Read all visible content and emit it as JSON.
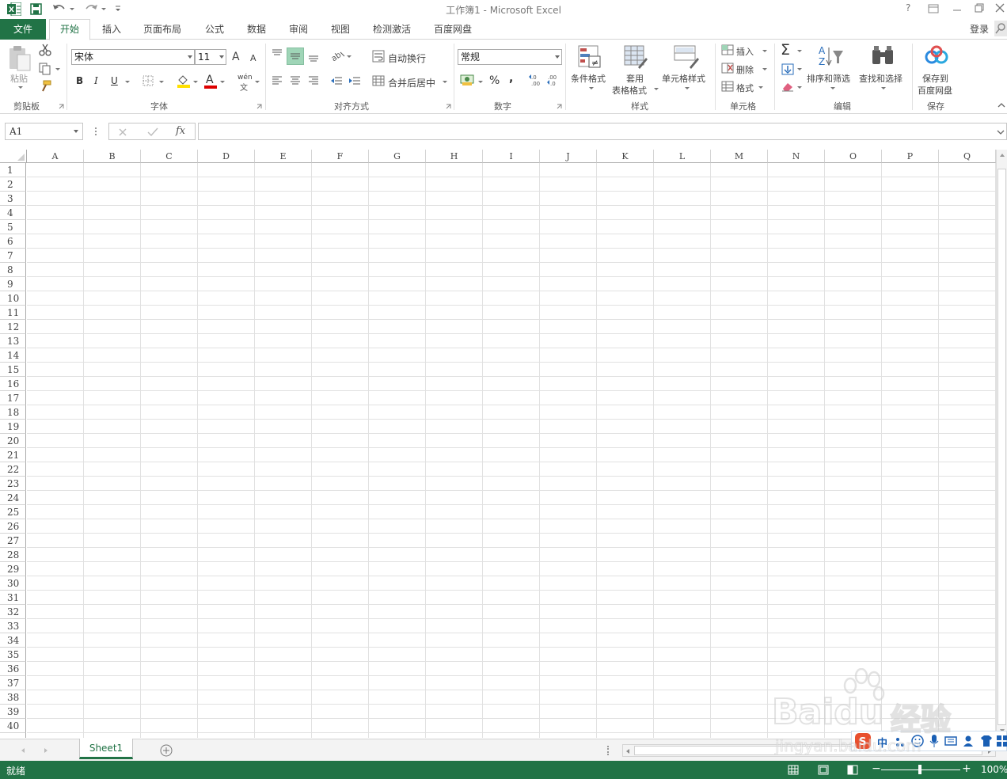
{
  "app": {
    "window_title": "工作簿1 - Microsoft Excel",
    "login": "登录",
    "help": "?"
  },
  "tabs": [
    {
      "label": "文件"
    },
    {
      "label": "开始"
    },
    {
      "label": "插入"
    },
    {
      "label": "页面布局"
    },
    {
      "label": "公式"
    },
    {
      "label": "数据"
    },
    {
      "label": "审阅"
    },
    {
      "label": "视图"
    },
    {
      "label": "检测激活"
    },
    {
      "label": "百度网盘"
    }
  ],
  "ribbon": {
    "clipboard": {
      "label": "剪贴板",
      "paste": "粘贴"
    },
    "font": {
      "label": "字体",
      "family": "宋体",
      "size": "11",
      "bold": "B",
      "italic": "I",
      "underline": "U",
      "grow": "A",
      "shrink": "A",
      "font_color": "A",
      "phonetic": "wén"
    },
    "alignment": {
      "label": "对齐方式",
      "wrap": "自动换行",
      "merge": "合并后居中"
    },
    "number": {
      "label": "数字",
      "format": "常规",
      "percent": "%",
      "comma": ","
    },
    "styles": {
      "label": "样式",
      "conditional": "条件格式",
      "table_format_1": "套用",
      "table_format_2": "表格格式",
      "cell_styles": "单元格样式"
    },
    "cells": {
      "label": "单元格",
      "insert": "插入",
      "delete": "删除",
      "format": "格式"
    },
    "editing": {
      "label": "编辑",
      "sort": "排序和筛选",
      "find": "查找和选择"
    },
    "save": {
      "label": "保存",
      "save1": "保存到",
      "save2": "百度网盘"
    }
  },
  "formula_bar": {
    "name_box": "A1",
    "fx": "fx",
    "value": ""
  },
  "grid": {
    "columns": [
      "A",
      "B",
      "C",
      "D",
      "E",
      "F",
      "G",
      "H",
      "I",
      "J",
      "K",
      "L",
      "M",
      "N",
      "O",
      "P",
      "Q"
    ],
    "rows": [
      "1",
      "2",
      "3",
      "4",
      "5",
      "6",
      "7",
      "8",
      "9",
      "10",
      "11",
      "12",
      "13",
      "14",
      "15",
      "16",
      "17",
      "18",
      "19",
      "20",
      "21",
      "22",
      "23",
      "24",
      "25",
      "26",
      "27",
      "28",
      "29",
      "30",
      "31",
      "32",
      "33",
      "34",
      "35",
      "36",
      "37",
      "38",
      "39",
      "40"
    ]
  },
  "sheets": [
    {
      "name": "Sheet1"
    }
  ],
  "status": {
    "ready": "就绪",
    "zoom": "100%"
  },
  "watermark": {
    "brand": "Baidu",
    "cn": "经验",
    "url": "jingyan.baidu.com"
  },
  "ime": {
    "mode": "中"
  },
  "colors": {
    "excel_green": "#217346",
    "accent_red": "#c00000"
  }
}
